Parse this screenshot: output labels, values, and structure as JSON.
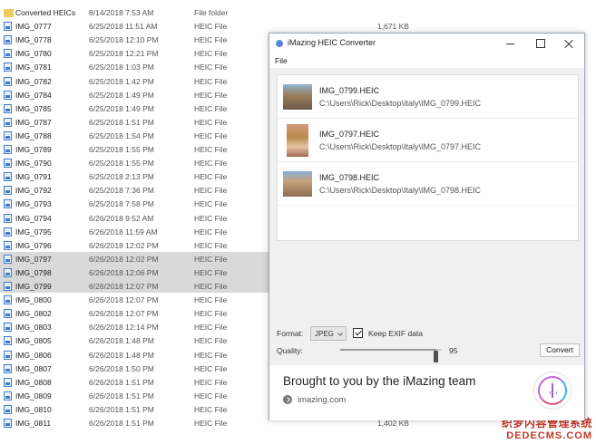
{
  "explorer": {
    "files": [
      {
        "name": "Converted HEICs",
        "date": "8/14/2018 7:53 AM",
        "type": "File folder",
        "size": "",
        "folder": true,
        "selected": false
      },
      {
        "name": "IMG_0777",
        "date": "6/25/2018 11:51 AM",
        "type": "HEIC File",
        "size": "1,671 KB",
        "folder": false,
        "selected": false
      },
      {
        "name": "IMG_0778",
        "date": "6/25/2018 12:10 PM",
        "type": "HEIC File",
        "size": "",
        "folder": false,
        "selected": false
      },
      {
        "name": "IMG_0780",
        "date": "6/25/2018 12:21 PM",
        "type": "HEIC File",
        "size": "",
        "folder": false,
        "selected": false
      },
      {
        "name": "IMG_0781",
        "date": "6/25/2018 1:03 PM",
        "type": "HEIC File",
        "size": "",
        "folder": false,
        "selected": false
      },
      {
        "name": "IMG_0782",
        "date": "6/25/2018 1:42 PM",
        "type": "HEIC File",
        "size": "",
        "folder": false,
        "selected": false
      },
      {
        "name": "IMG_0784",
        "date": "6/25/2018 1:49 PM",
        "type": "HEIC File",
        "size": "",
        "folder": false,
        "selected": false
      },
      {
        "name": "IMG_0785",
        "date": "6/25/2018 1:49 PM",
        "type": "HEIC File",
        "size": "",
        "folder": false,
        "selected": false
      },
      {
        "name": "IMG_0787",
        "date": "6/25/2018 1:51 PM",
        "type": "HEIC File",
        "size": "",
        "folder": false,
        "selected": false
      },
      {
        "name": "IMG_0788",
        "date": "6/25/2018 1:54 PM",
        "type": "HEIC File",
        "size": "",
        "folder": false,
        "selected": false
      },
      {
        "name": "IMG_0789",
        "date": "6/25/2018 1:55 PM",
        "type": "HEIC File",
        "size": "",
        "folder": false,
        "selected": false
      },
      {
        "name": "IMG_0790",
        "date": "6/25/2018 1:55 PM",
        "type": "HEIC File",
        "size": "",
        "folder": false,
        "selected": false
      },
      {
        "name": "IMG_0791",
        "date": "6/25/2018 2:13 PM",
        "type": "HEIC File",
        "size": "",
        "folder": false,
        "selected": false
      },
      {
        "name": "IMG_0792",
        "date": "6/25/2018 7:36 PM",
        "type": "HEIC File",
        "size": "",
        "folder": false,
        "selected": false
      },
      {
        "name": "IMG_0793",
        "date": "6/25/2018 7:58 PM",
        "type": "HEIC File",
        "size": "",
        "folder": false,
        "selected": false
      },
      {
        "name": "IMG_0794",
        "date": "6/26/2018 9:52 AM",
        "type": "HEIC File",
        "size": "",
        "folder": false,
        "selected": false
      },
      {
        "name": "IMG_0795",
        "date": "6/26/2018 11:59 AM",
        "type": "HEIC File",
        "size": "",
        "folder": false,
        "selected": false
      },
      {
        "name": "IMG_0796",
        "date": "6/26/2018 12:02 PM",
        "type": "HEIC File",
        "size": "",
        "folder": false,
        "selected": false
      },
      {
        "name": "IMG_0797",
        "date": "6/26/2018 12:02 PM",
        "type": "HEIC File",
        "size": "",
        "folder": false,
        "selected": true
      },
      {
        "name": "IMG_0798",
        "date": "6/26/2018 12:06 PM",
        "type": "HEIC File",
        "size": "",
        "folder": false,
        "selected": true
      },
      {
        "name": "IMG_0799",
        "date": "6/26/2018 12:07 PM",
        "type": "HEIC File",
        "size": "",
        "folder": false,
        "selected": true
      },
      {
        "name": "IMG_0800",
        "date": "6/26/2018 12:07 PM",
        "type": "HEIC File",
        "size": "",
        "folder": false,
        "selected": false
      },
      {
        "name": "IMG_0802",
        "date": "6/26/2018 12:07 PM",
        "type": "HEIC File",
        "size": "",
        "folder": false,
        "selected": false
      },
      {
        "name": "IMG_0803",
        "date": "6/26/2018 12:14 PM",
        "type": "HEIC File",
        "size": "",
        "folder": false,
        "selected": false
      },
      {
        "name": "IMG_0805",
        "date": "6/26/2018 1:48 PM",
        "type": "HEIC File",
        "size": "",
        "folder": false,
        "selected": false
      },
      {
        "name": "IMG_0806",
        "date": "6/26/2018 1:48 PM",
        "type": "HEIC File",
        "size": "",
        "folder": false,
        "selected": false
      },
      {
        "name": "IMG_0807",
        "date": "6/26/2018 1:50 PM",
        "type": "HEIC File",
        "size": "",
        "folder": false,
        "selected": false
      },
      {
        "name": "IMG_0808",
        "date": "6/26/2018 1:51 PM",
        "type": "HEIC File",
        "size": "",
        "folder": false,
        "selected": false
      },
      {
        "name": "IMG_0809",
        "date": "6/26/2018 1:51 PM",
        "type": "HEIC File",
        "size": "",
        "folder": false,
        "selected": false
      },
      {
        "name": "IMG_0810",
        "date": "6/26/2018 1:51 PM",
        "type": "HEIC File",
        "size": "",
        "folder": false,
        "selected": false
      },
      {
        "name": "IMG_0811",
        "date": "6/26/2018 1:51 PM",
        "type": "HEIC File",
        "size": "1,402 KB",
        "folder": false,
        "selected": false
      }
    ]
  },
  "converter": {
    "title": "iMazing HEIC Converter",
    "menu_file": "File",
    "entries": [
      {
        "name": "IMG_0799.HEIC",
        "path": "C:\\Users\\Rick\\Desktop\\Italy\\IMG_0799.HEIC"
      },
      {
        "name": "IMG_0797.HEIC",
        "path": "C:\\Users\\Rick\\Desktop\\Italy\\IMG_0797.HEIC"
      },
      {
        "name": "IMG_0798.HEIC",
        "path": "C:\\Users\\Rick\\Desktop\\Italy\\IMG_0798.HEIC"
      }
    ],
    "format_label": "Format:",
    "format_value": "JPEG",
    "exif_label": "Keep EXIF data",
    "exif_checked": true,
    "quality_label": "Quality:",
    "quality_value": "95",
    "quality_level": 0.95,
    "convert_label": "Convert",
    "banner_text": "Brought to you by the iMazing team",
    "banner_link": "imazing.com"
  },
  "watermark": {
    "line1": "织梦内容管理系统",
    "line2": "DEDECMS.COM"
  }
}
